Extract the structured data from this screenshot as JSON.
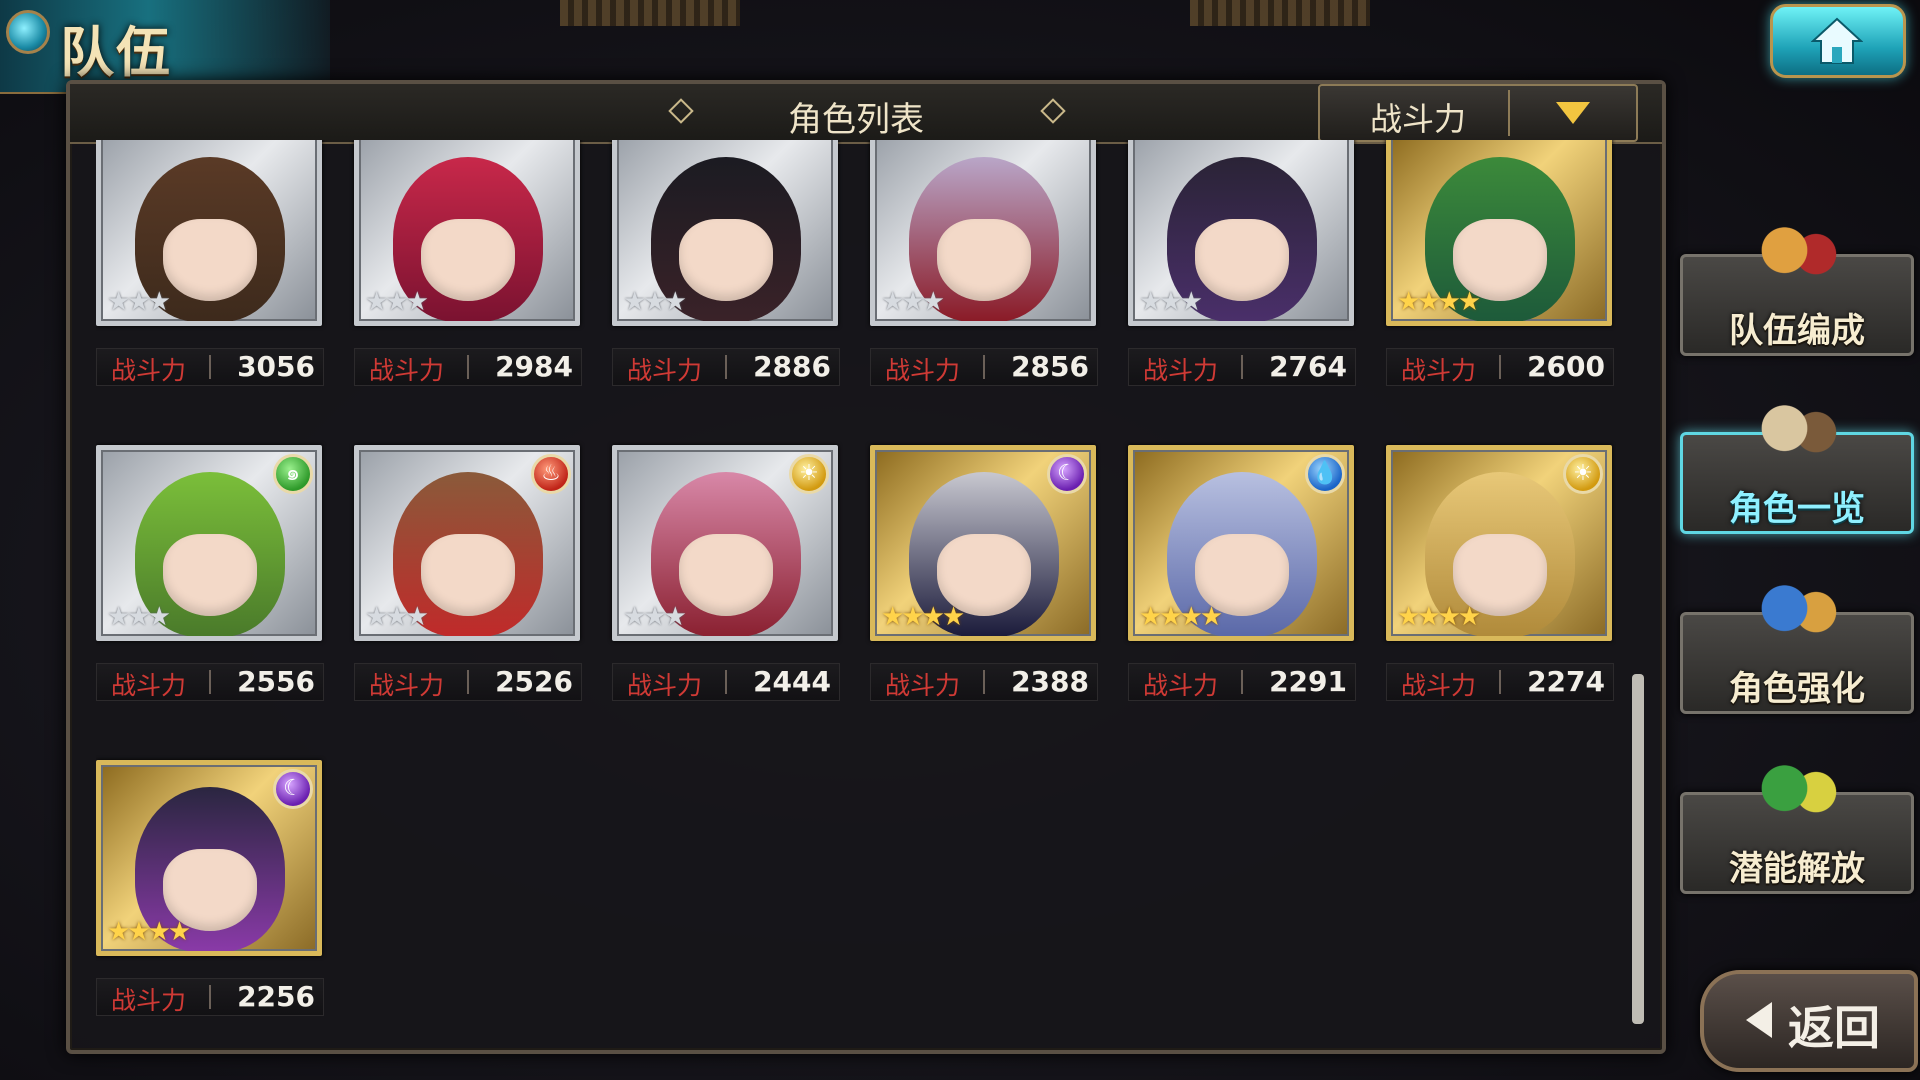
{
  "header": {
    "title": "队伍"
  },
  "panel": {
    "title": "角色列表",
    "sort_label": "战斗力"
  },
  "cards": [
    {
      "power_label": "战斗力",
      "power": "3056",
      "rarity": 3,
      "stars": "★★★",
      "element": null,
      "colors": [
        "#5a3a26",
        "#3d2a1c"
      ]
    },
    {
      "power_label": "战斗力",
      "power": "2984",
      "rarity": 3,
      "stars": "★★★",
      "element": null,
      "colors": [
        "#c8284a",
        "#7a1230"
      ]
    },
    {
      "power_label": "战斗力",
      "power": "2886",
      "rarity": 3,
      "stars": "★★★",
      "element": null,
      "colors": [
        "#1b1b22",
        "#3a2228"
      ]
    },
    {
      "power_label": "战斗力",
      "power": "2856",
      "rarity": 3,
      "stars": "★★★",
      "element": null,
      "colors": [
        "#b9a6c8",
        "#8a1a26"
      ]
    },
    {
      "power_label": "战斗力",
      "power": "2764",
      "rarity": 3,
      "stars": "★★★",
      "element": null,
      "colors": [
        "#2a2336",
        "#4a2f6a"
      ]
    },
    {
      "power_label": "战斗力",
      "power": "2600",
      "rarity": 4,
      "stars": "★★★★",
      "element": null,
      "colors": [
        "#3c8a3a",
        "#1d5a3a"
      ]
    },
    {
      "power_label": "战斗力",
      "power": "2556",
      "rarity": 3,
      "stars": "★★★",
      "element": "wind",
      "colors": [
        "#7bbf3a",
        "#4a7a2a"
      ]
    },
    {
      "power_label": "战斗力",
      "power": "2526",
      "rarity": 3,
      "stars": "★★★",
      "element": "fire",
      "colors": [
        "#8a5a3a",
        "#c02a2a"
      ]
    },
    {
      "power_label": "战斗力",
      "power": "2444",
      "rarity": 3,
      "stars": "★★★",
      "element": "light",
      "colors": [
        "#d888a8",
        "#8a2030"
      ]
    },
    {
      "power_label": "战斗力",
      "power": "2388",
      "rarity": 4,
      "stars": "★★★★",
      "element": "dark",
      "colors": [
        "#c8c8d0",
        "#1a1a3a"
      ]
    },
    {
      "power_label": "战斗力",
      "power": "2291",
      "rarity": 4,
      "stars": "★★★★",
      "element": "water",
      "colors": [
        "#b8c0e0",
        "#5a68a8"
      ]
    },
    {
      "power_label": "战斗力",
      "power": "2274",
      "rarity": 4,
      "stars": "★★★★",
      "element": "light",
      "colors": [
        "#e8c878",
        "#b08a3a"
      ]
    },
    {
      "power_label": "战斗力",
      "power": "2256",
      "rarity": 4,
      "stars": "★★★★",
      "element": "dark",
      "colors": [
        "#2a2640",
        "#8a3aa8"
      ]
    }
  ],
  "element_icons": {
    "wind": "wind-icon",
    "fire": "fire-icon",
    "light": "sun-icon",
    "dark": "moon-icon",
    "water": "water-drop-icon"
  },
  "element_glyphs": {
    "wind": "๑",
    "fire": "♨",
    "light": "☀",
    "dark": "☾",
    "water": "💧"
  },
  "side_menu": [
    {
      "label": "队伍编成",
      "name": "team-formation-button",
      "active": false
    },
    {
      "label": "角色一览",
      "name": "character-list-button",
      "active": true
    },
    {
      "label": "角色强化",
      "name": "character-enhance-button",
      "active": false
    },
    {
      "label": "潜能解放",
      "name": "potential-release-button",
      "active": false
    }
  ],
  "back_label": "返回",
  "colors": {
    "accent": "#5fd7e3",
    "power_label": "#d03a35",
    "gold_frame": "#d9b95a",
    "silver_frame": "#c5c9ce"
  }
}
